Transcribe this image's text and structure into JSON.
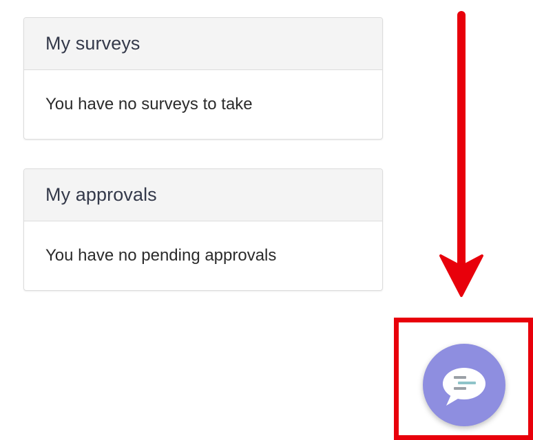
{
  "surveys": {
    "title": "My surveys",
    "empty_text": "You have no surveys to take"
  },
  "approvals": {
    "title": "My approvals",
    "empty_text": "You have no pending approvals"
  },
  "chat_widget": {
    "icon": "chat-bubble-icon",
    "color": "#8e8ee0"
  },
  "annotation": {
    "arrow_icon": "arrow-down-icon",
    "color": "#e8000b"
  }
}
